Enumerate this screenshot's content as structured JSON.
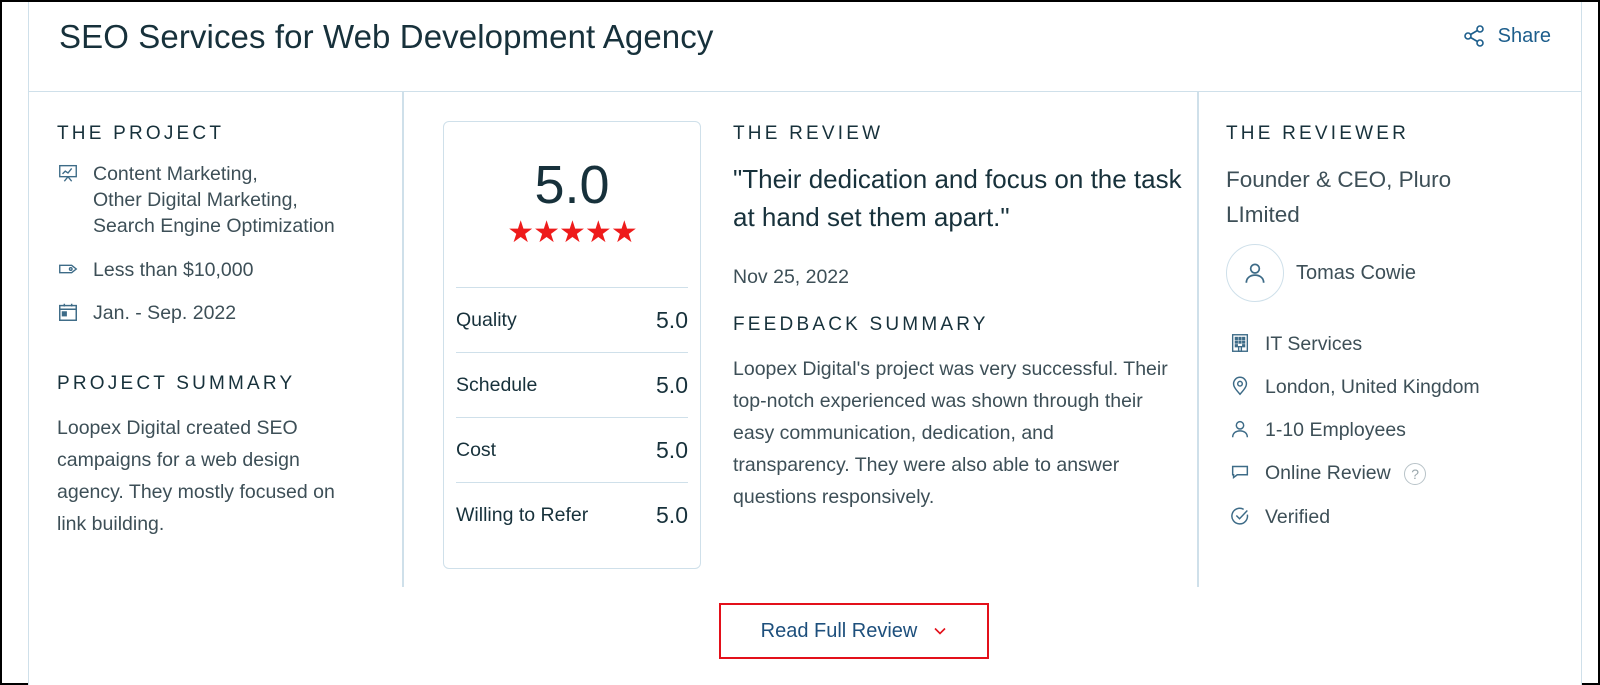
{
  "header": {
    "title": "SEO Services for Web Development Agency",
    "share_label": "Share"
  },
  "project": {
    "section_title": "THE PROJECT",
    "services": [
      "Content Marketing,",
      "Other Digital Marketing,",
      "Search Engine Optimization"
    ],
    "budget": "Less than $10,000",
    "dates": "Jan. - Sep. 2022",
    "summary_title": "PROJECT SUMMARY",
    "summary_lines": [
      "Loopex Digital created SEO",
      "campaigns for a web design",
      "agency. They mostly focused on",
      "link building."
    ]
  },
  "rating": {
    "overall": "5.0",
    "stars": "★★★★★",
    "star_count": 5,
    "star_color": "#ee1b1b",
    "scores": [
      {
        "label": "Quality",
        "value": "5.0"
      },
      {
        "label": "Schedule",
        "value": "5.0"
      },
      {
        "label": "Cost",
        "value": "5.0"
      },
      {
        "label": "Willing to Refer",
        "value": "5.0"
      }
    ]
  },
  "review": {
    "section_title": "THE REVIEW",
    "quote": "\"Their dedication and focus on the task at hand set them apart.\"",
    "date": "Nov 25, 2022",
    "feedback_title": "FEEDBACK SUMMARY",
    "feedback_lines": [
      "Loopex Digital's project was very successful. Their",
      "top-notch experienced was shown through their",
      "easy communication, dedication, and",
      "transparency. They were also able to answer",
      "questions responsively."
    ]
  },
  "reviewer": {
    "section_title": "THE REVIEWER",
    "role_lines": [
      "Founder & CEO, Pluro",
      "LImited"
    ],
    "name": "Tomas Cowie",
    "industry": "IT Services",
    "location": "London, United Kingdom",
    "employees": "1-10 Employees",
    "review_type": "Online Review",
    "help_glyph": "?",
    "verified": "Verified"
  },
  "footer": {
    "read_full_label": "Read Full Review"
  },
  "colors": {
    "brand_text": "#17313b",
    "link": "#1d5e8c",
    "divider": "#cfe0ea",
    "highlight_border": "#e3101a"
  }
}
